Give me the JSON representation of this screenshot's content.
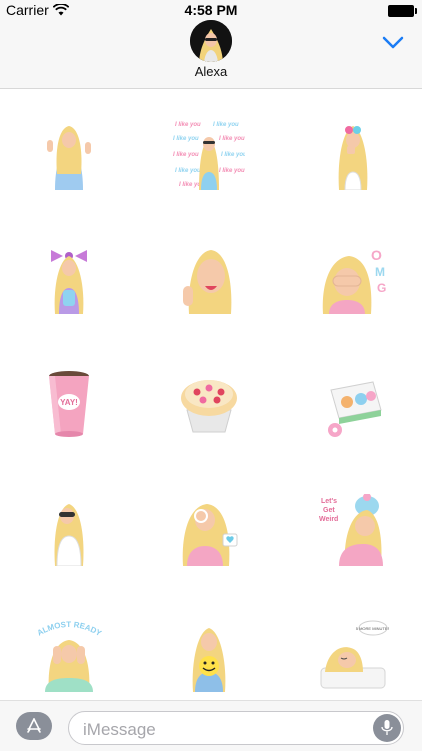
{
  "status_bar": {
    "carrier": "Carrier",
    "time": "4:58 PM"
  },
  "header": {
    "contact_name": "Alexa",
    "avatar_icon": "profile-avatar",
    "collapse_icon": "chevron-down-icon",
    "accent_color": "#1a7cf5"
  },
  "stickers": [
    {
      "name": "girl-peace-sign",
      "bg": "#cfe6ff"
    },
    {
      "name": "i-like-you",
      "text": "I like you"
    },
    {
      "name": "girl-sunglasses-pink"
    },
    {
      "name": "girl-pink-bow"
    },
    {
      "name": "girl-wink-tongue"
    },
    {
      "name": "girl-omg",
      "text": "OMG!"
    },
    {
      "name": "yay-cup",
      "text": "YAY!"
    },
    {
      "name": "heart-cupcake"
    },
    {
      "name": "donut-box"
    },
    {
      "name": "girl-sunglasses-white"
    },
    {
      "name": "girl-heart-sign"
    },
    {
      "name": "lets-get-weird",
      "text": "Let's Get Weird"
    },
    {
      "name": "almost-ready",
      "text": "ALMOST READY"
    },
    {
      "name": "girl-smiley-balloon"
    },
    {
      "name": "5-more-minutes",
      "text": "5 MORE MINUTES"
    }
  ],
  "input_bar": {
    "placeholder": "iMessage",
    "appstore_icon": "appstore-icon",
    "mic_icon": "microphone-icon"
  }
}
